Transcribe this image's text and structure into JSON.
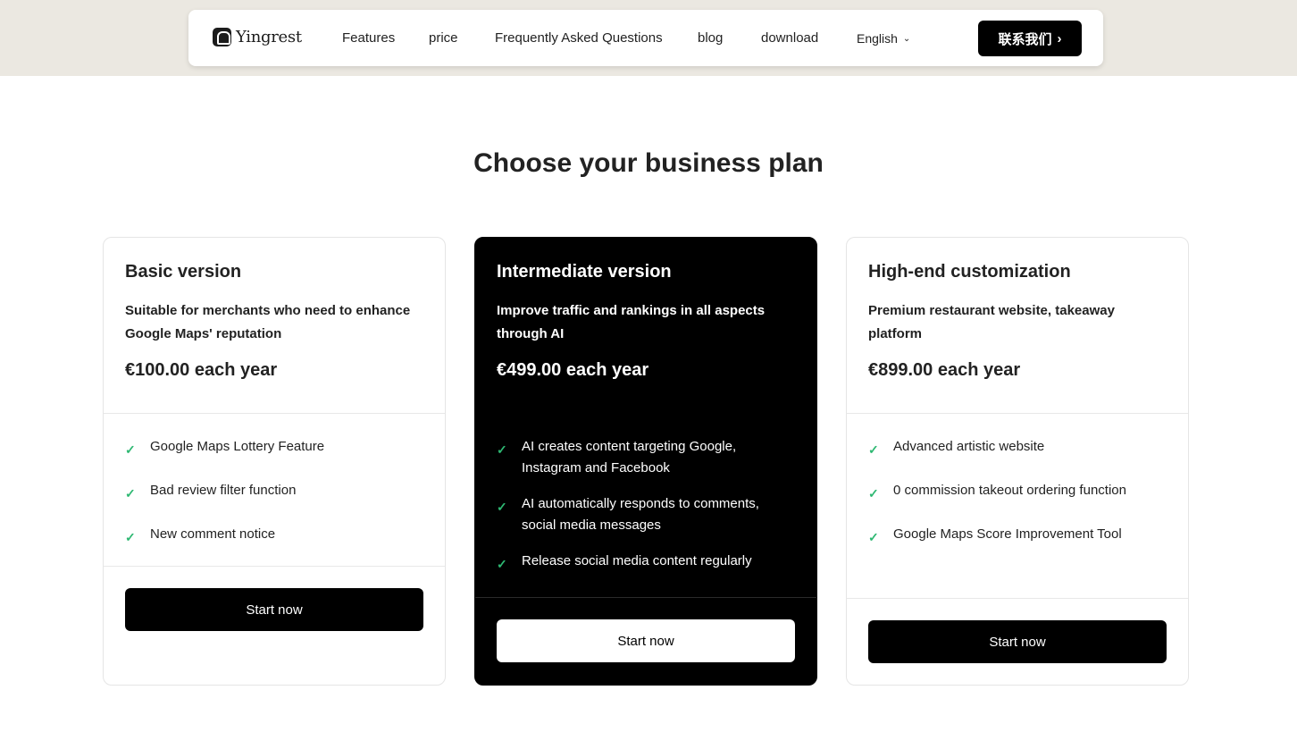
{
  "nav": {
    "logo_text": "Yingrest",
    "links": [
      "Features",
      "price",
      "Frequently Asked Questions",
      "blog",
      "download"
    ],
    "language": "English",
    "contact_label": "联系我们"
  },
  "heading": "Choose your business plan",
  "plans": [
    {
      "title": "Basic version",
      "description": "Suitable for merchants who need to enhance Google Maps' reputation",
      "price": "€100.00 each year",
      "features": [
        "Google Maps Lottery Feature",
        "Bad review filter function",
        "New comment notice"
      ],
      "button": "Start now"
    },
    {
      "title": "Intermediate version",
      "description": "Improve traffic and rankings in all aspects through AI",
      "price": "€499.00 each year",
      "features": [
        "AI creates content targeting Google, Instagram and Facebook",
        "AI automatically responds to comments, social media messages",
        "Release social media content regularly"
      ],
      "button": "Start now"
    },
    {
      "title": "High-end customization",
      "description": "Premium restaurant website, takeaway platform",
      "price": "€899.00 each year",
      "features": [
        "Advanced artistic website",
        "0 commission takeout ordering function",
        "Google Maps Score Improvement Tool"
      ],
      "button": "Start now"
    }
  ],
  "colors": {
    "accent_check": "#2eb872",
    "band": "#ebe8e1",
    "dark_card": "#000000"
  }
}
